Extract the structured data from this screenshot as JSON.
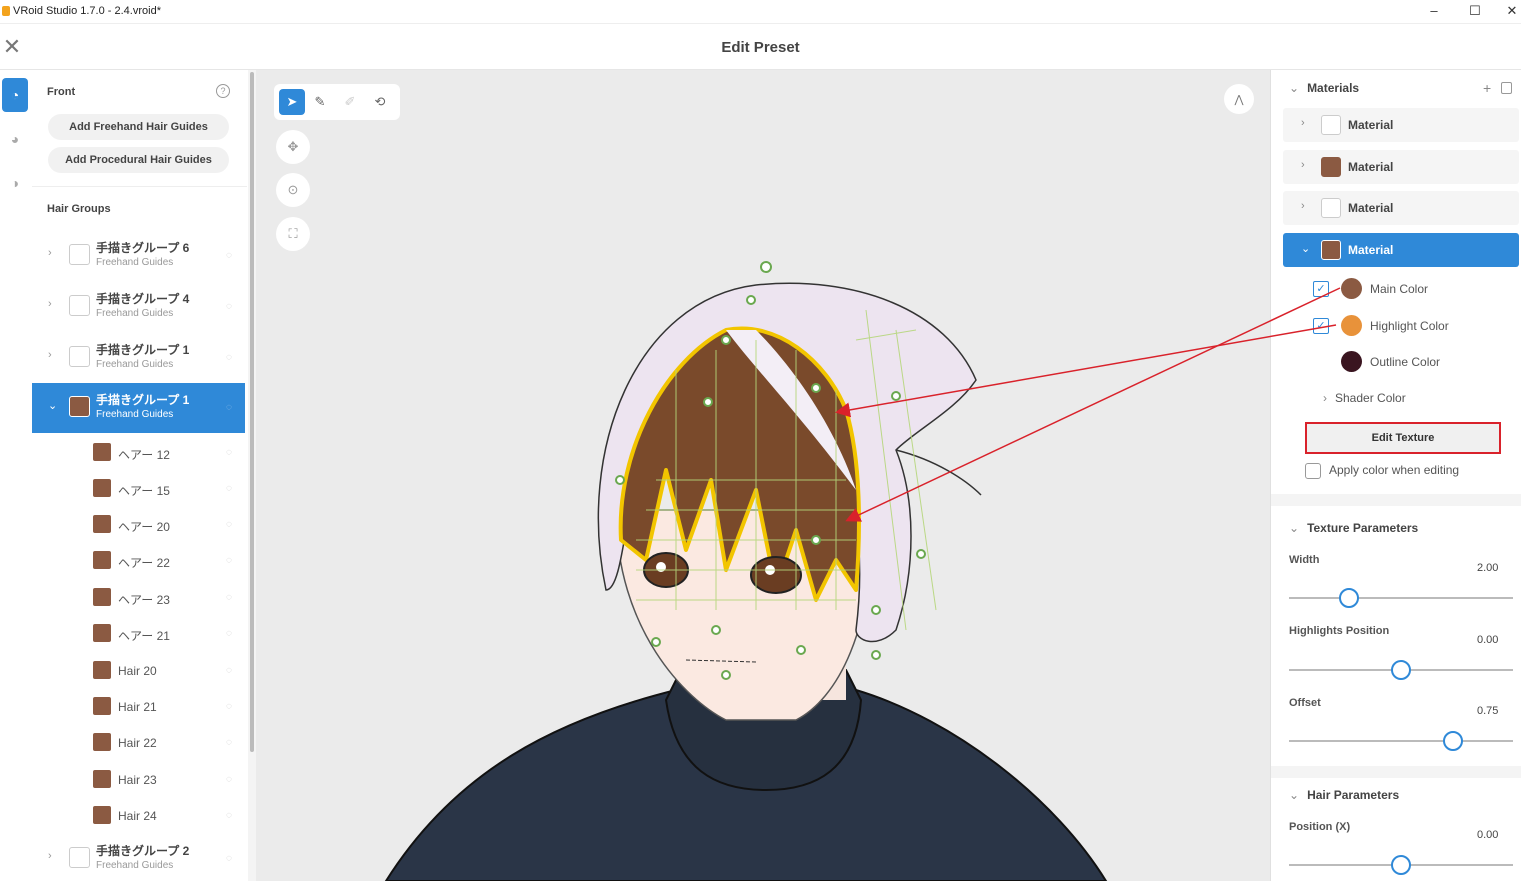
{
  "window": {
    "title": "VRoid Studio 1.7.0 - 2.4.vroid*",
    "min": "–",
    "max": "☐",
    "close": "✕"
  },
  "header": {
    "close": "✕",
    "title": "Edit Preset"
  },
  "left": {
    "front_label": "Front",
    "help": "?",
    "add_freehand": "Add Freehand Hair Guides",
    "add_procedural": "Add Procedural Hair Guides",
    "hair_groups_label": "Hair Groups",
    "groups": [
      {
        "name": "手描きグループ 6",
        "sub": "Freehand Guides"
      },
      {
        "name": "手描きグループ 4",
        "sub": "Freehand Guides"
      },
      {
        "name": "手描きグループ 1",
        "sub": "Freehand Guides"
      },
      {
        "name": "手描きグループ 1",
        "sub": "Freehand Guides"
      }
    ],
    "hairs": [
      "ヘアー 12",
      "ヘアー 15",
      "ヘアー 20",
      "ヘアー 22",
      "ヘアー 23",
      "ヘアー 21",
      "Hair 20",
      "Hair 21",
      "Hair 22",
      "Hair 23",
      "Hair 24"
    ],
    "last_group": {
      "name": "手描きグループ 2",
      "sub": "Freehand Guides"
    }
  },
  "colors": {
    "accent": "#2f89d8",
    "hair_brown": "#8b5a42",
    "main_color": "#8b5a42",
    "highlight_color": "#e8923a",
    "outline_color": "#3a1520",
    "annotation_red": "#d9222b"
  },
  "right": {
    "materials_title": "Materials",
    "materials": [
      "Material",
      "Material",
      "Material",
      "Material"
    ],
    "main_color": "Main Color",
    "highlight_color": "Highlight Color",
    "outline_color": "Outline Color",
    "shader_color": "Shader Color",
    "edit_texture": "Edit Texture",
    "apply_color": "Apply color when editing",
    "texture_params_title": "Texture Parameters",
    "width_label": "Width",
    "width_value": "2.00",
    "width_level": 0.27,
    "highlights_label": "Highlights Position",
    "highlights_value": "0.00",
    "highlights_level": 0.5,
    "offset_label": "Offset",
    "offset_value": "0.75",
    "offset_level": 0.73,
    "hair_params_title": "Hair Parameters",
    "posx_label": "Position (X)",
    "posx_value": "0.00",
    "posx_level": 0.5
  }
}
